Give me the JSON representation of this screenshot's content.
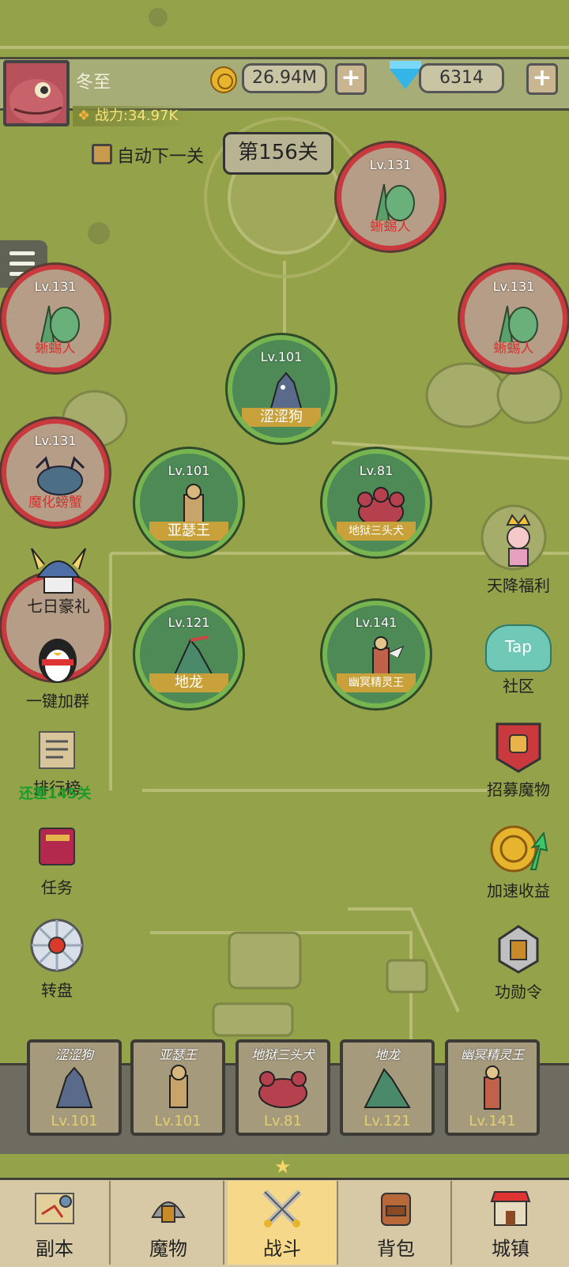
{
  "player": {
    "name": "冬至",
    "power": "战力:34.97K"
  },
  "currency": {
    "gold": "26.94M",
    "gems": "6314",
    "plus_label": "+"
  },
  "stage": {
    "auto_next_label": "自动下一关",
    "current": "第156关"
  },
  "enemies": [
    {
      "name": "蜥蜴人",
      "level": "Lv.131"
    },
    {
      "name": "蜥蜴人",
      "level": "Lv.131"
    },
    {
      "name": "蜥蜴人",
      "level": "Lv.131"
    },
    {
      "name": "魔化螃蟹",
      "level": "Lv.131"
    }
  ],
  "allies": [
    {
      "name": "涩涩狗",
      "level": "Lv.101"
    },
    {
      "name": "亚瑟王",
      "level": "Lv.101"
    },
    {
      "name": "地狱三头犬",
      "level": "Lv.81"
    },
    {
      "name": "地龙",
      "level": "Lv.121"
    },
    {
      "name": "幽冥精灵王",
      "level": "Lv.141"
    }
  ],
  "left_menu": {
    "seven_day": "七日豪礼",
    "join_group": "一键加群",
    "ranking": "排行榜",
    "ranking_note": "还差145关",
    "tasks": "任务",
    "wheel": "转盘"
  },
  "right_menu": {
    "welfare": "天降福利",
    "community": "社区",
    "community_tap": "Tap",
    "recruit": "招募魔物",
    "speed": "加速收益",
    "merit": "功勋令"
  },
  "roster": [
    {
      "name": "涩涩狗",
      "level": "Lv.101"
    },
    {
      "name": "亚瑟王",
      "level": "Lv.101"
    },
    {
      "name": "地狱三头犬",
      "level": "Lv.81"
    },
    {
      "name": "地龙",
      "level": "Lv.121"
    },
    {
      "name": "幽冥精灵王",
      "level": "Lv.141"
    }
  ],
  "nav": {
    "tabs": [
      {
        "label": "副本"
      },
      {
        "label": "魔物"
      },
      {
        "label": "战斗"
      },
      {
        "label": "背包"
      },
      {
        "label": "城镇"
      }
    ],
    "active": "战斗"
  },
  "colors": {
    "background": "#94a24a",
    "enemy_ring": "#c9393d",
    "ally_ring": "#78b550",
    "active_tab": "#f5d88a"
  }
}
